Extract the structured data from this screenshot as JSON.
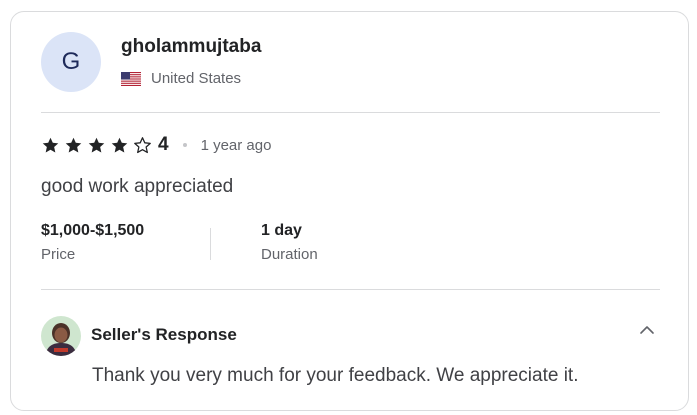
{
  "reviewer": {
    "avatar_letter": "G",
    "username": "gholammujtaba",
    "country": "United States",
    "flag_icon": "us-flag-icon"
  },
  "review": {
    "rating_stars": 4,
    "rating_max": 5,
    "score_label": "4",
    "time_ago": "1 year ago",
    "text": "good work appreciated"
  },
  "meta": {
    "price_value": "$1,000-$1,500",
    "price_label": "Price",
    "duration_value": "1 day",
    "duration_label": "Duration"
  },
  "seller_response": {
    "title": "Seller's Response",
    "text": "Thank you very much for your feedback. We appreciate it.",
    "collapse_icon": "chevron-up-icon"
  },
  "colors": {
    "avatar_bg": "#dbe4f7",
    "avatar_letter": "#1e2a5a",
    "text_primary": "#222325",
    "text_secondary": "#62646a",
    "border": "#dadbdd"
  }
}
